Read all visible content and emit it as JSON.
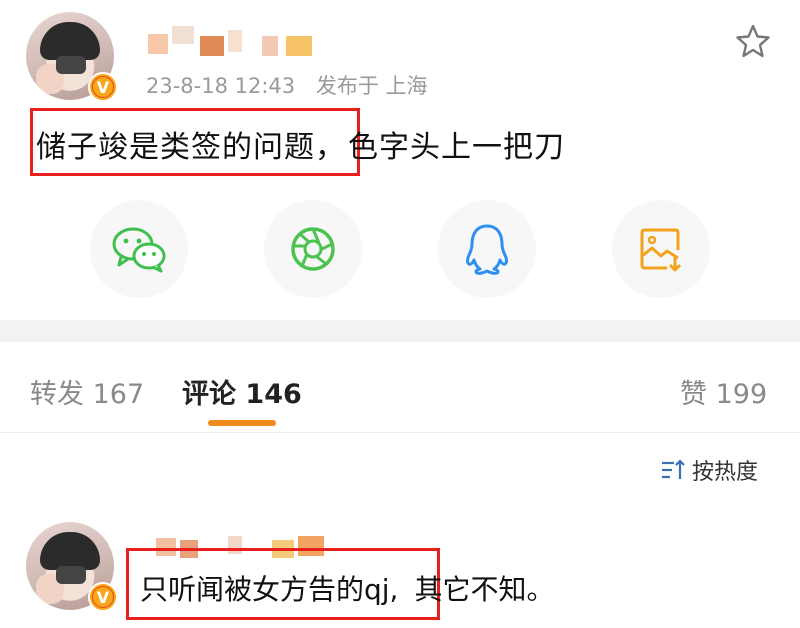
{
  "post": {
    "time": "23-8-18 12:43",
    "location_prefix": "发布于 上海",
    "text_highlighted": "储子竣是类签的问题，",
    "text_rest": "色字头上一把刀"
  },
  "share": {
    "icons": [
      "wechat-icon",
      "moments-icon",
      "qq-icon",
      "save-image-icon"
    ],
    "colors": {
      "wechat": "#3fbf4e",
      "moments": "#4cc24f",
      "qq": "#2f8ff0",
      "save": "#f3a21c"
    }
  },
  "tabs": {
    "repost": {
      "label": "转发",
      "count": "167"
    },
    "comment": {
      "label": "评论",
      "count": "146"
    },
    "like": {
      "label": "赞",
      "count": "199"
    }
  },
  "sort": {
    "label": "按热度"
  },
  "comment": {
    "text_highlighted": "只听闻被女方告的qj,",
    "text_rest": "其它不知。"
  },
  "colors": {
    "accent": "#f08a1c",
    "highlight_box": "#e8201d",
    "badge": "#f8a61c"
  }
}
